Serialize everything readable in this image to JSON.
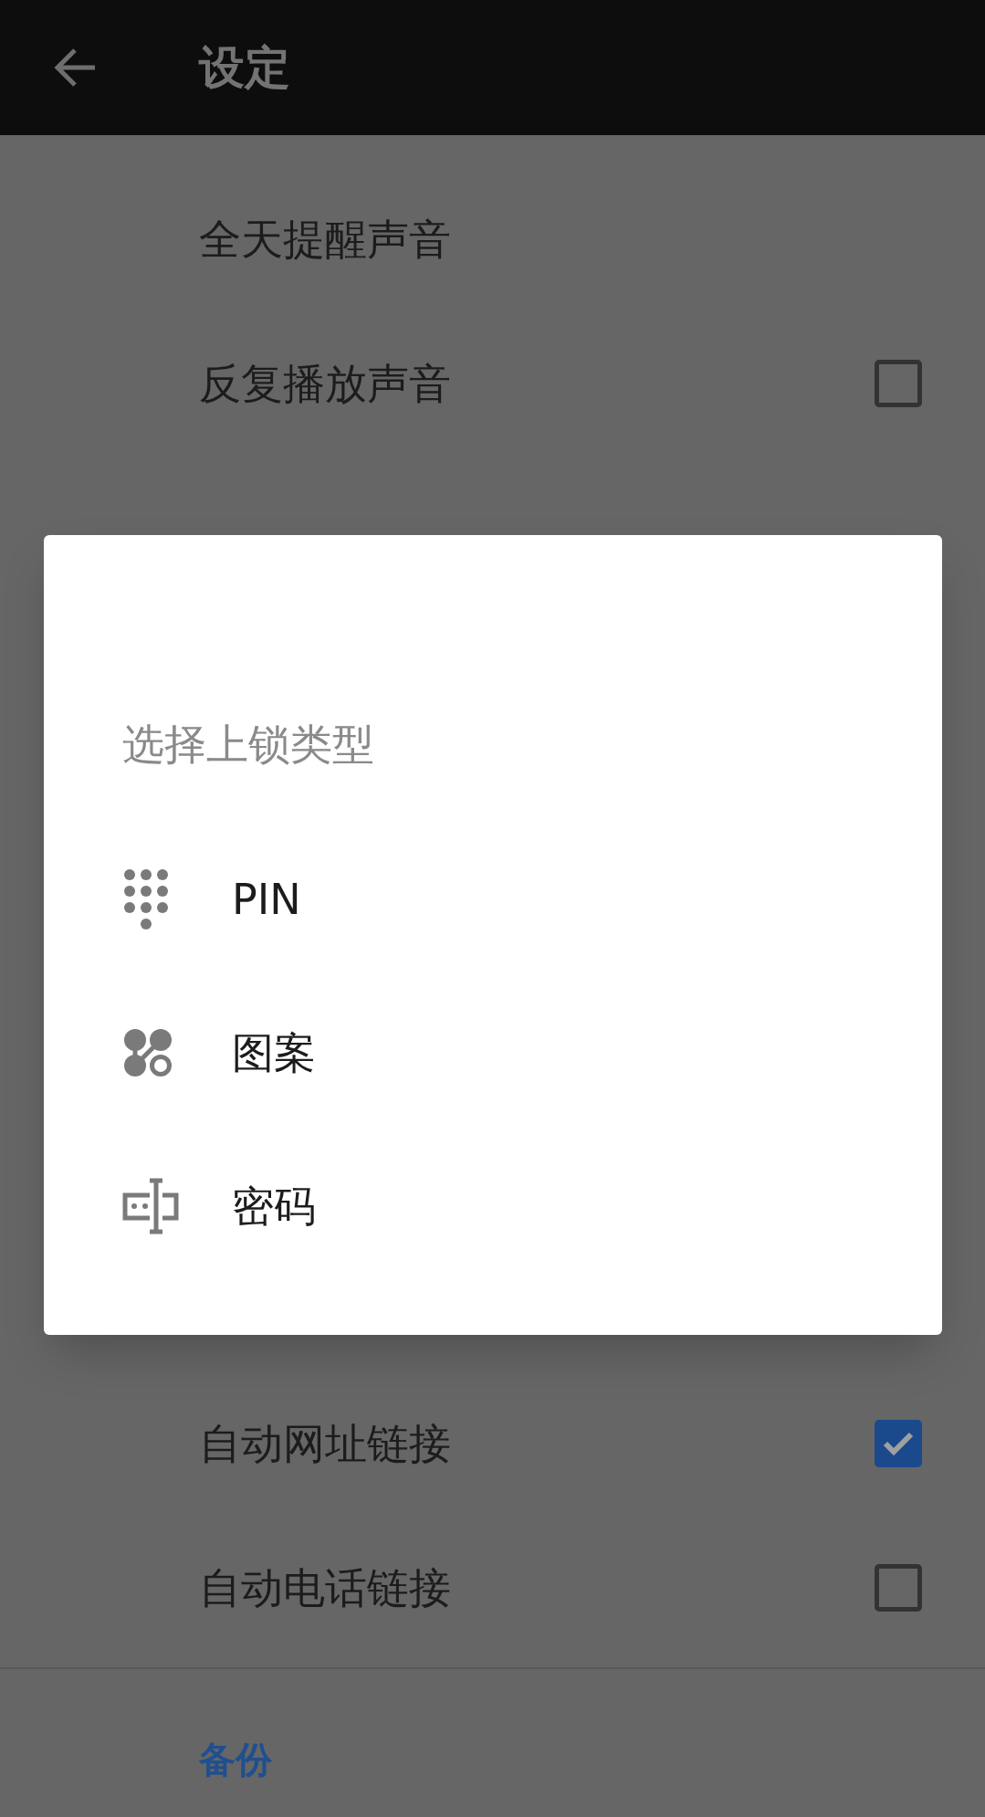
{
  "app_bar": {
    "title": "设定"
  },
  "settings_top": [
    {
      "label": "全天提醒声音",
      "kind": "plain"
    },
    {
      "label": "反复播放声音",
      "kind": "checkbox",
      "checked": false
    }
  ],
  "settings_bottom": [
    {
      "label": "自动网址链接",
      "kind": "checkbox",
      "checked": true
    },
    {
      "label": "自动电话链接",
      "kind": "checkbox",
      "checked": false
    }
  ],
  "section_header": "备份",
  "dialog": {
    "title": "选择上锁类型",
    "options": [
      {
        "label": "PIN",
        "kind": "pin"
      },
      {
        "label": "图案",
        "kind": "pattern"
      },
      {
        "label": "密码",
        "kind": "password"
      }
    ]
  }
}
